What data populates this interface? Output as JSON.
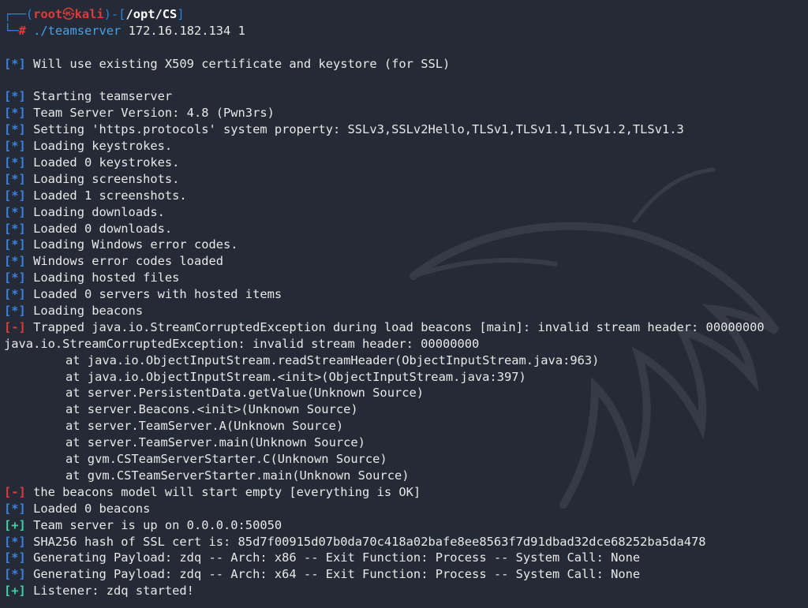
{
  "prompt": {
    "corner_top": "┌──(",
    "user": "root",
    "at_symbol": "㉿",
    "host": "kali",
    "mid": ")-[",
    "path": "/opt/CS",
    "end": "]",
    "corner_bottom": "└─",
    "hash": "#",
    "command": "./teamserver",
    "args": " 172.16.182.134 1"
  },
  "lines": [
    {
      "tag": "[*]",
      "kind": "info",
      "text": "Will use existing X509 certificate and keystore (for SSL)"
    },
    {
      "blank": true
    },
    {
      "tag": "[*]",
      "kind": "info",
      "text": "Starting teamserver"
    },
    {
      "tag": "[*]",
      "kind": "info",
      "text": "Team Server Version: 4.8 (Pwn3rs)"
    },
    {
      "tag": "[*]",
      "kind": "info",
      "text": "Setting 'https.protocols' system property: SSLv3,SSLv2Hello,TLSv1,TLSv1.1,TLSv1.2,TLSv1.3"
    },
    {
      "tag": "[*]",
      "kind": "info",
      "text": "Loading keystrokes."
    },
    {
      "tag": "[*]",
      "kind": "info",
      "text": "Loaded 0 keystrokes."
    },
    {
      "tag": "[*]",
      "kind": "info",
      "text": "Loading screenshots."
    },
    {
      "tag": "[*]",
      "kind": "info",
      "text": "Loaded 1 screenshots."
    },
    {
      "tag": "[*]",
      "kind": "info",
      "text": "Loading downloads."
    },
    {
      "tag": "[*]",
      "kind": "info",
      "text": "Loaded 0 downloads."
    },
    {
      "tag": "[*]",
      "kind": "info",
      "text": "Loading Windows error codes."
    },
    {
      "tag": "[*]",
      "kind": "info",
      "text": "Windows error codes loaded"
    },
    {
      "tag": "[*]",
      "kind": "info",
      "text": "Loading hosted files"
    },
    {
      "tag": "[*]",
      "kind": "info",
      "text": "Loaded 0 servers with hosted items"
    },
    {
      "tag": "[*]",
      "kind": "info",
      "text": "Loading beacons"
    },
    {
      "tag": "[-]",
      "kind": "err",
      "text": "Trapped java.io.StreamCorruptedException during load beacons [main]: invalid stream header: 00000000"
    },
    {
      "kind": "plain",
      "text": "java.io.StreamCorruptedException: invalid stream header: 00000000"
    },
    {
      "kind": "trace",
      "text": "at java.io.ObjectInputStream.readStreamHeader(ObjectInputStream.java:963)"
    },
    {
      "kind": "trace",
      "text": "at java.io.ObjectInputStream.<init>(ObjectInputStream.java:397)"
    },
    {
      "kind": "trace",
      "text": "at server.PersistentData.getValue(Unknown Source)"
    },
    {
      "kind": "trace",
      "text": "at server.Beacons.<init>(Unknown Source)"
    },
    {
      "kind": "trace",
      "text": "at server.TeamServer.A(Unknown Source)"
    },
    {
      "kind": "trace",
      "text": "at server.TeamServer.main(Unknown Source)"
    },
    {
      "kind": "trace",
      "text": "at gvm.CSTeamServerStarter.C(Unknown Source)"
    },
    {
      "kind": "trace",
      "text": "at gvm.CSTeamServerStarter.main(Unknown Source)"
    },
    {
      "tag": "[-]",
      "kind": "err",
      "text": "the beacons model will start empty [everything is OK]"
    },
    {
      "tag": "[*]",
      "kind": "info",
      "text": "Loaded 0 beacons"
    },
    {
      "tag": "[+]",
      "kind": "ok",
      "text": "Team server is up on 0.0.0.0:50050"
    },
    {
      "tag": "[*]",
      "kind": "info",
      "text": "SHA256 hash of SSL cert is: 85d7f00915d07b0da70c418a02bafe8ee8563f7d91dbad32dce68252ba5da478"
    },
    {
      "tag": "[*]",
      "kind": "info",
      "text": "Generating Payload: zdq -- Arch: x86 -- Exit Function: Process -- System Call: None"
    },
    {
      "tag": "[*]",
      "kind": "info",
      "text": "Generating Payload: zdq -- Arch: x64 -- Exit Function: Process -- System Call: None"
    },
    {
      "tag": "[+]",
      "kind": "ok",
      "text": "Listener: zdq started!"
    }
  ]
}
